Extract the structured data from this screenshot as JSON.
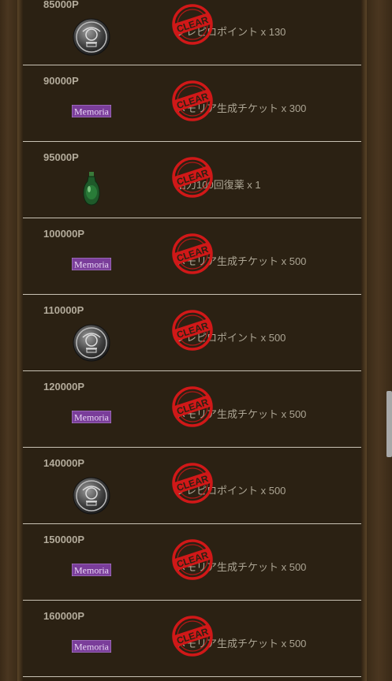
{
  "rewards": [
    {
      "points": "85000P",
      "icon": "medal-coin-icon",
      "reward": "フレピロポイント x 130",
      "status": "CLEAR"
    },
    {
      "points": "90000P",
      "icon": "memoria-ticket-icon",
      "icon_label": "Memoria",
      "reward": "メモリア生成チケット x 300",
      "status": "CLEAR"
    },
    {
      "points": "95000P",
      "icon": "green-potion-icon",
      "reward": "活力100回復薬 x 1",
      "status": "CLEAR"
    },
    {
      "points": "100000P",
      "icon": "memoria-ticket-icon",
      "icon_label": "Memoria",
      "reward": "メモリア生成チケット x 500",
      "status": "CLEAR"
    },
    {
      "points": "110000P",
      "icon": "medal-coin-icon",
      "reward": "フレピロポイント x 500",
      "status": "CLEAR"
    },
    {
      "points": "120000P",
      "icon": "memoria-ticket-icon",
      "icon_label": "Memoria",
      "reward": "メモリア生成チケット x 500",
      "status": "CLEAR"
    },
    {
      "points": "140000P",
      "icon": "medal-coin-icon",
      "reward": "フレピロポイント x 500",
      "status": "CLEAR"
    },
    {
      "points": "150000P",
      "icon": "memoria-ticket-icon",
      "icon_label": "Memoria",
      "reward": "メモリア生成チケット x 500",
      "status": "CLEAR"
    },
    {
      "points": "160000P",
      "icon": "memoria-ticket-icon",
      "icon_label": "Memoria",
      "reward": "メモリア生成チケット x 500",
      "status": "CLEAR"
    }
  ],
  "colors": {
    "row_bg": "#2b2113",
    "points_text": "#b3ab9b",
    "reward_text": "#aba493",
    "stamp_red": "#d01818",
    "memoria_purple": "#7a3d9a"
  }
}
